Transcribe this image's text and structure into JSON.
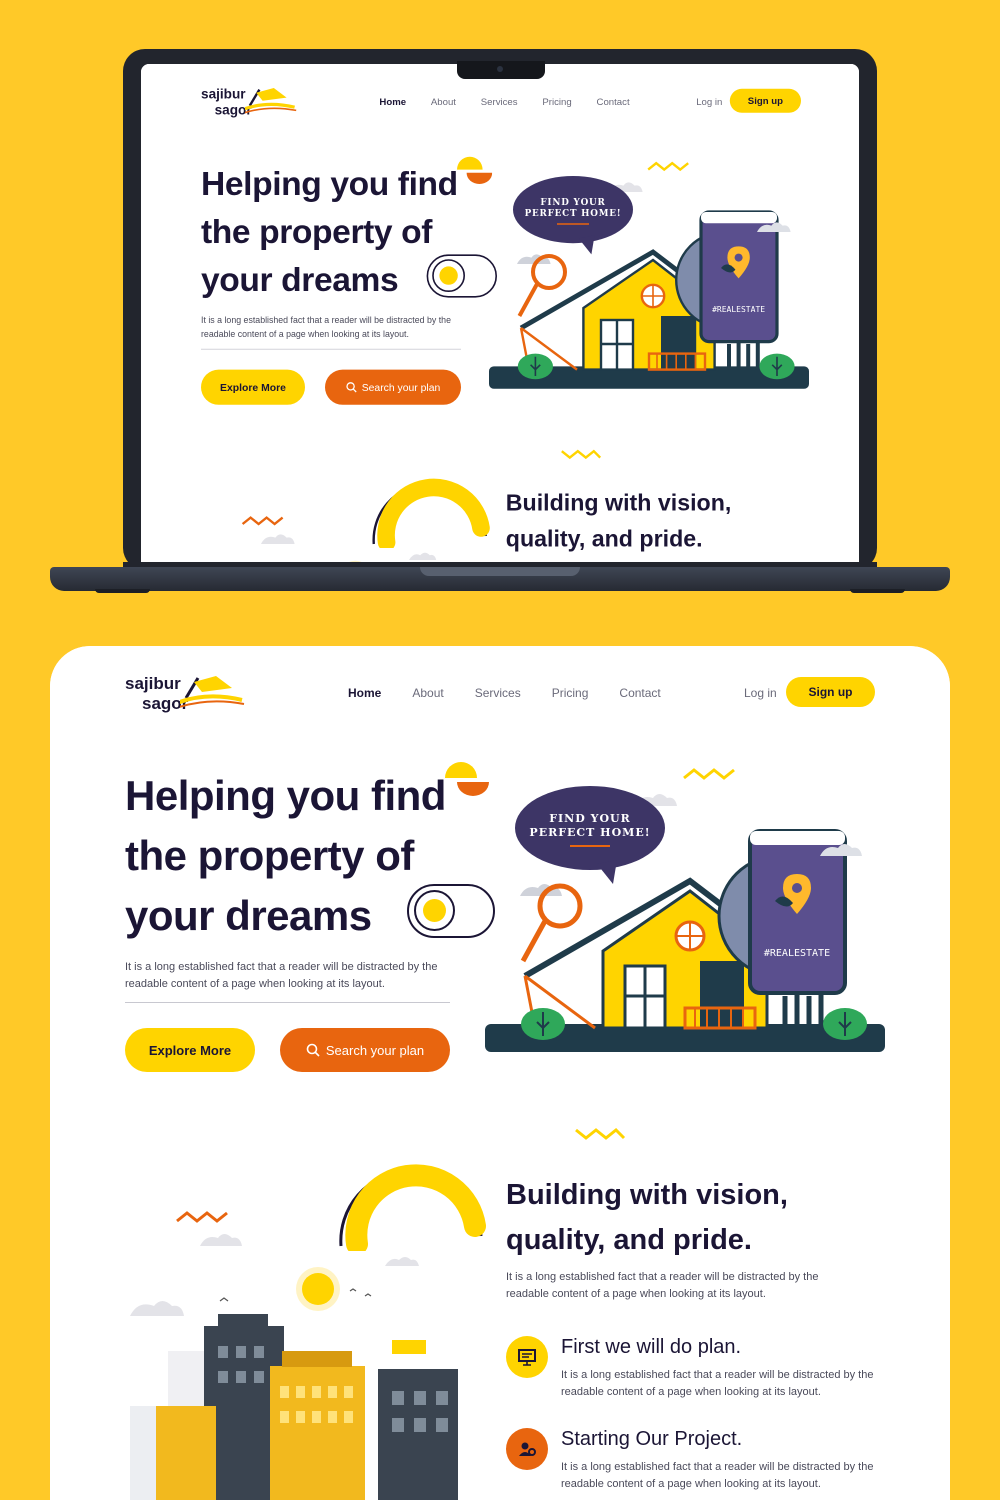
{
  "brand": {
    "line1": "sajibur",
    "line2": "sagor"
  },
  "nav": {
    "home": "Home",
    "about": "About",
    "services": "Services",
    "pricing": "Pricing",
    "contact": "Contact"
  },
  "auth": {
    "login": "Log in",
    "signup": "Sign up"
  },
  "hero": {
    "line1": "Helping you find",
    "line2": "the property of",
    "line3": "your dreams",
    "description": "It is a long established fact that a reader will be distracted by the readable content of a page when looking at its layout.",
    "explore_button": "Explore More",
    "search_button": "Search your plan",
    "bubble_line1": "FIND YOUR",
    "bubble_line2": "PERFECT HOME!",
    "phone_tag": "#REALESTATE"
  },
  "section2": {
    "title_line1": "Building with vision,",
    "title_line2": "quality, and pride.",
    "description": "It is a long established fact that a reader will be distracted by the readable content of a page when looking at its layout.",
    "steps": [
      {
        "title": "First we will do plan.",
        "description": "It is a long established fact that a reader will be distracted by the readable content of a page when looking at its layout.",
        "icon": "presentation-board-icon",
        "color": "#FFD400"
      },
      {
        "title": "Starting Our Project.",
        "description": "It is a long established fact that a reader will be distracted by the readable content of a page when looking at its layout.",
        "icon": "team-gear-icon",
        "color": "#E8650F"
      }
    ]
  },
  "colors": {
    "background": "#FFC928",
    "accent_yellow": "#FFD400",
    "accent_orange": "#E8650F",
    "navy": "#1b1535",
    "purple": "#4b3f7a"
  }
}
